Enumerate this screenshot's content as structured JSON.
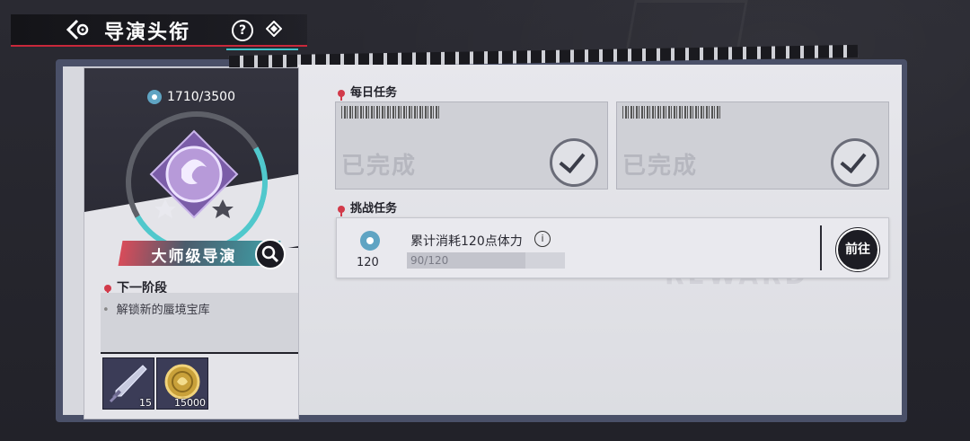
{
  "header": {
    "title": "导演头衔"
  },
  "card": {
    "progress": "1710/3500",
    "rank_name": "大师级导演",
    "next_stage_label": "下一阶段",
    "next_stage_item": "解锁新的蜃境宝库",
    "rewards": [
      {
        "icon": "dagger-icon",
        "count": "15"
      },
      {
        "icon": "gold-coin-icon",
        "count": "15000"
      }
    ]
  },
  "daily": {
    "label": "每日任务",
    "cards": [
      {
        "status": "已完成"
      },
      {
        "status": "已完成"
      }
    ]
  },
  "challenge": {
    "label": "挑战任务",
    "task": {
      "cost": "120",
      "title": "累计消耗120点体力",
      "progress_text": "90/120",
      "progress_fraction": 0.75,
      "button": "前往"
    }
  },
  "watermark": "REWARD",
  "colors": {
    "accent_red": "#d23a4a",
    "accent_cyan": "#3ec3c9",
    "dark": "#1d1d24"
  }
}
